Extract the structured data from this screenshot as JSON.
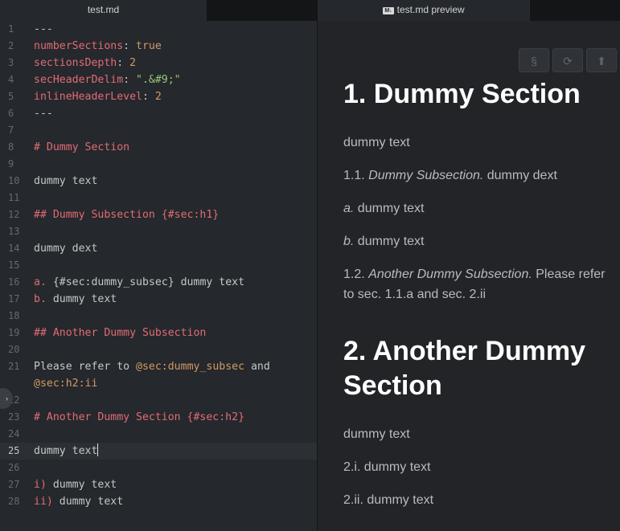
{
  "tabs": {
    "editor": "test.md",
    "preview_badge": "M↓",
    "preview": "test.md preview"
  },
  "editor": {
    "line_numbers": [
      "1",
      "2",
      "3",
      "4",
      "5",
      "6",
      "7",
      "8",
      "9",
      "10",
      "11",
      "12",
      "13",
      "14",
      "15",
      "16",
      "17",
      "18",
      "19",
      "20",
      "21",
      "",
      "22",
      "23",
      "24",
      "25",
      "26",
      "27",
      "28"
    ],
    "l1": "---",
    "l2_key": "numberSections",
    "l2_sep": ": ",
    "l2_val": "true",
    "l3_key": "sectionsDepth",
    "l3_sep": ": ",
    "l3_val": "2",
    "l4_key": "secHeaderDelim",
    "l4_sep": ": ",
    "l4_val": "\".&#9;\"",
    "l5_key": "inlineHeaderLevel",
    "l5_sep": ": ",
    "l5_val": "2",
    "l6": "---",
    "l8": "# Dummy Section",
    "l10": "dummy text",
    "l12": "## Dummy Subsection {#sec:h1}",
    "l14": "dummy dext",
    "l16_marker": "a.",
    "l16_rest": " {#sec:dummy_subsec} dummy text",
    "l17_marker": "b.",
    "l17_rest": " dummy text",
    "l19": "## Another Dummy Subsection",
    "l21_a": "Please refer to ",
    "l21_ref1": "@sec:dummy_subsec",
    "l21_b": " and",
    "l21_ref2": "@sec:h2:ii",
    "l23": "# Another Dummy Section {#sec:h2}",
    "l25": "dummy text",
    "l27_marker": "i)",
    "l27_rest": " dummy text",
    "l28_marker": "ii)",
    "l28_rest": " dummy text"
  },
  "preview": {
    "toolbar": {
      "btn1": "§",
      "btn2": "⟳",
      "btn3": "⬆"
    },
    "h1_a": "1. Dummy Section",
    "p1": "dummy text",
    "p2_num": "1.1. ",
    "p2_em": "Dummy Subsection.",
    "p2_rest": " dummy dext",
    "p3_em": "a.",
    "p3_rest": " dummy text",
    "p4_em": "b.",
    "p4_rest": " dummy text",
    "p5_num": "1.2. ",
    "p5_em": "Another Dummy Subsection.",
    "p5_rest": " Please refer to sec. 1.1.a and sec. 2.ii",
    "h1_b": "2. Another Dummy Section",
    "p6": "dummy text",
    "p7": "2.i. dummy text",
    "p8": "2.ii. dummy text"
  }
}
